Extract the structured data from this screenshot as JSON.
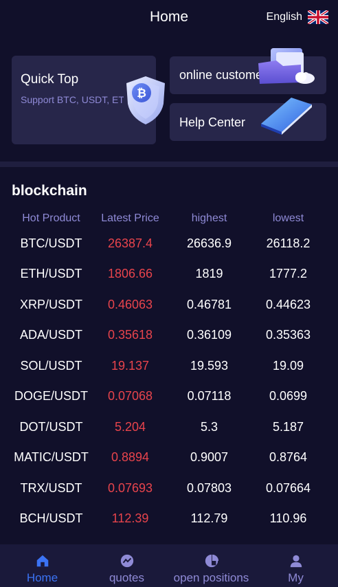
{
  "header": {
    "title": "Home",
    "language": "English"
  },
  "cards": {
    "quick_top": {
      "title": "Quick Top",
      "subtitle": "Support BTC, USDT, ETH"
    },
    "online_service": {
      "title": "online customer service"
    },
    "help_center": {
      "title": "Help Center"
    }
  },
  "market": {
    "section_title": "blockchain",
    "headers": [
      "Hot Product",
      "Latest Price",
      "highest",
      "lowest"
    ],
    "rows": [
      {
        "pair": "BTC/USDT",
        "latest": "26387.4",
        "high": "26636.9",
        "low": "26118.2"
      },
      {
        "pair": "ETH/USDT",
        "latest": "1806.66",
        "high": "1819",
        "low": "1777.2"
      },
      {
        "pair": "XRP/USDT",
        "latest": "0.46063",
        "high": "0.46781",
        "low": "0.44623"
      },
      {
        "pair": "ADA/USDT",
        "latest": "0.35618",
        "high": "0.36109",
        "low": "0.35363"
      },
      {
        "pair": "SOL/USDT",
        "latest": "19.137",
        "high": "19.593",
        "low": "19.09"
      },
      {
        "pair": "DOGE/USDT",
        "latest": "0.07068",
        "high": "0.07118",
        "low": "0.0699"
      },
      {
        "pair": "DOT/USDT",
        "latest": "5.204",
        "high": "5.3",
        "low": "5.187"
      },
      {
        "pair": "MATIC/USDT",
        "latest": "0.8894",
        "high": "0.9007",
        "low": "0.8764"
      },
      {
        "pair": "TRX/USDT",
        "latest": "0.07693",
        "high": "0.07803",
        "low": "0.07664"
      },
      {
        "pair": "BCH/USDT",
        "latest": "112.39",
        "high": "112.79",
        "low": "110.96"
      }
    ]
  },
  "nav": {
    "items": [
      {
        "label": "Home",
        "icon": "home-icon",
        "active": true
      },
      {
        "label": "quotes",
        "icon": "chart-icon",
        "active": false
      },
      {
        "label": "open positions",
        "icon": "pie-chart-icon",
        "active": false
      },
      {
        "label": "My",
        "icon": "user-icon",
        "active": false
      }
    ]
  },
  "colors": {
    "background": "#11102a",
    "card": "#27264a",
    "accent": "#3b73f4",
    "price_red": "#e8444c",
    "muted": "#8f8ad6"
  }
}
